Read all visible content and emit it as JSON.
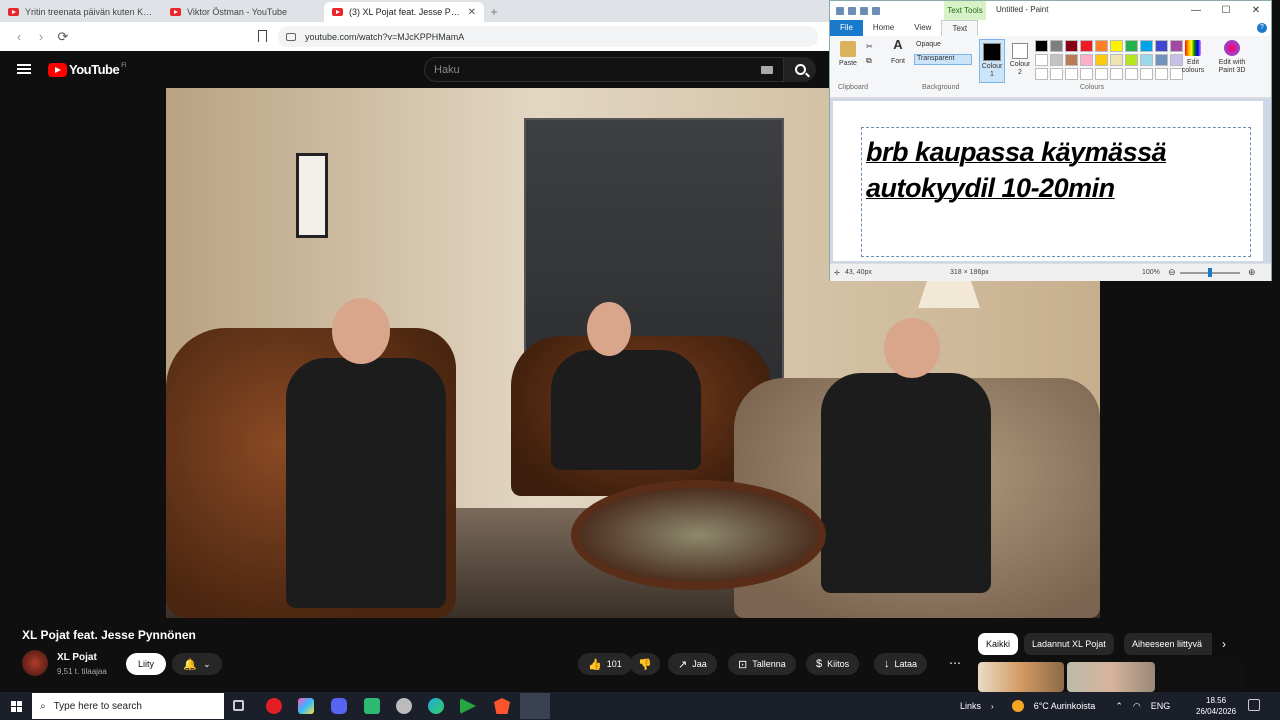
{
  "browser": {
    "tabs": [
      {
        "title": "Yritin treenata päivän kuten Klebo -",
        "active": false
      },
      {
        "title": "Viktor Östman - YouTube",
        "active": false
      },
      {
        "title": "(3) XL Pojat feat. Jesse Pynnö",
        "active": true
      }
    ],
    "url": "youtube.com/watch?v=MJcKPPHMamA"
  },
  "youtube": {
    "logo": "YouTube",
    "country": "FI",
    "search_placeholder": "Haku",
    "video_title": "XL Pojat feat. Jesse Pynnönen",
    "channel": {
      "name": "XL Pojat",
      "subscribers": "9,51 t. tilaajaa"
    },
    "join_label": "Liity",
    "likes": "101",
    "actions": {
      "share": "Jaa",
      "save": "Tallenna",
      "thanks": "Kiitos",
      "download": "Lataa"
    },
    "chips": [
      "Kaikki",
      "Ladannut XL Pojat",
      "Aiheeseen liittyvä"
    ]
  },
  "paint": {
    "title": "Untitled - Paint",
    "context_tab": "Text Tools",
    "tabs": [
      "File",
      "Home",
      "View",
      "Text"
    ],
    "ribbon": {
      "paste": "Paste",
      "font": "Font",
      "opaque": "Opaque",
      "transparent": "Transparent",
      "colour1": "Colour 1",
      "colour2": "Colour 2",
      "edit_colours": "Edit colours",
      "edit_paint3d": "Edit with Paint 3D",
      "group_clipboard": "Clipboard",
      "group_background": "Background",
      "group_colours": "Colours"
    },
    "palette": [
      "#000000",
      "#7f7f7f",
      "#880015",
      "#ed1c24",
      "#ff7f27",
      "#fff200",
      "#22b14c",
      "#00a2e8",
      "#3f48cc",
      "#a349a4",
      "#ffffff",
      "#c3c3c3",
      "#b97a57",
      "#ffaec9",
      "#ffc90e",
      "#efe4b0",
      "#b5e61d",
      "#99d9ea",
      "#7092be",
      "#c8bfe7"
    ],
    "text_line1": "brb kaupassa käymässä",
    "text_line2": "autokyydil 10-20min",
    "status": {
      "cursor": "43, 40px",
      "selection": "318 × 186px",
      "zoom": "100%"
    }
  },
  "taskbar": {
    "search_placeholder": "Type here to search",
    "links": "Links",
    "weather": "6°C Aurinkoista",
    "lang": "ENG",
    "time": "18.56",
    "date": "26/04/2026"
  }
}
